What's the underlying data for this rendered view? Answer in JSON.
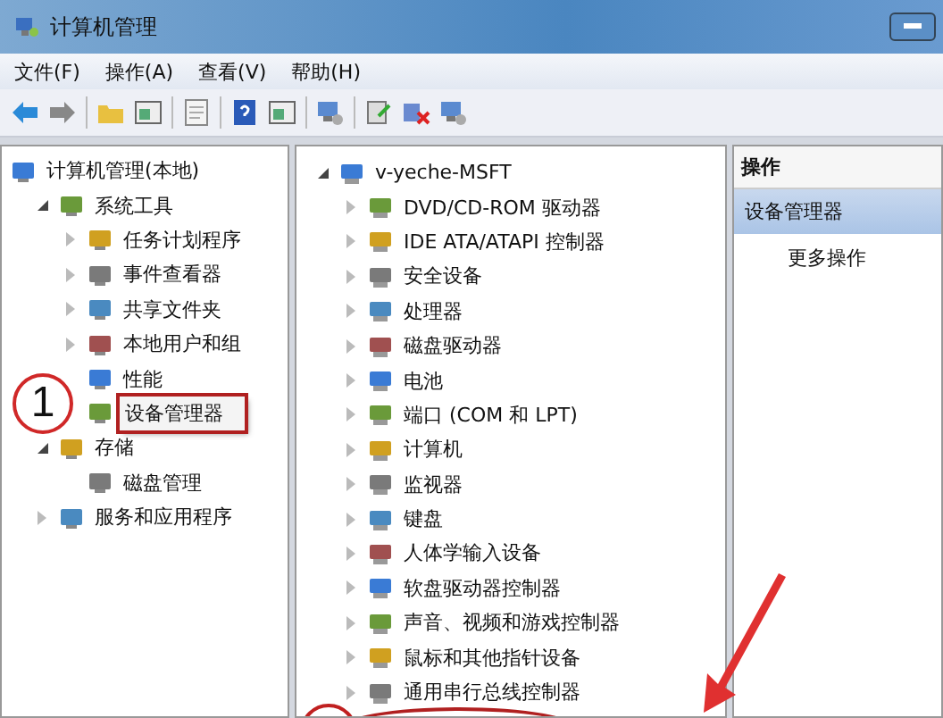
{
  "window": {
    "title": "计算机管理"
  },
  "menu": [
    "文件(F)",
    "操作(A)",
    "查看(V)",
    "帮助(H)"
  ],
  "left_tree": [
    {
      "label": "计算机管理(本地)",
      "children": [
        {
          "label": "系统工具",
          "expanded": true,
          "children": [
            {
              "label": "任务计划程序",
              "expanded": false
            },
            {
              "label": "事件查看器",
              "expanded": false
            },
            {
              "label": "共享文件夹",
              "expanded": false
            },
            {
              "label": "本地用户和组",
              "expanded": false
            },
            {
              "label": "性能"
            },
            {
              "label": "设备管理器",
              "boxed": true
            }
          ]
        },
        {
          "label": "存储",
          "expanded": true,
          "children": [
            {
              "label": "磁盘管理"
            }
          ]
        },
        {
          "label": "服务和应用程序",
          "expanded": false
        }
      ]
    }
  ],
  "device_tree": [
    {
      "label": "v-yeche-MSFT",
      "expanded": true,
      "children": [
        {
          "label": "DVD/CD-ROM 驱动器",
          "expanded": false
        },
        {
          "label": "IDE ATA/ATAPI 控制器",
          "expanded": false
        },
        {
          "label": "安全设备",
          "expanded": false
        },
        {
          "label": "处理器",
          "expanded": false
        },
        {
          "label": "磁盘驱动器",
          "expanded": false
        },
        {
          "label": "电池",
          "expanded": false
        },
        {
          "label": "端口 (COM 和 LPT)",
          "expanded": false
        },
        {
          "label": "计算机",
          "expanded": false
        },
        {
          "label": "监视器",
          "expanded": false
        },
        {
          "label": "键盘",
          "expanded": false
        },
        {
          "label": "人体学输入设备",
          "expanded": false
        },
        {
          "label": "软盘驱动器控制器",
          "expanded": false
        },
        {
          "label": "声音、视频和游戏控制器",
          "expanded": false
        },
        {
          "label": "鼠标和其他指针设备",
          "expanded": false
        },
        {
          "label": "通用串行总线控制器",
          "expanded": false
        }
      ]
    }
  ],
  "actions": {
    "header": "操作",
    "section": "设备管理器",
    "items": [
      "更多操作"
    ]
  },
  "callouts": [
    {
      "label": "1"
    }
  ]
}
